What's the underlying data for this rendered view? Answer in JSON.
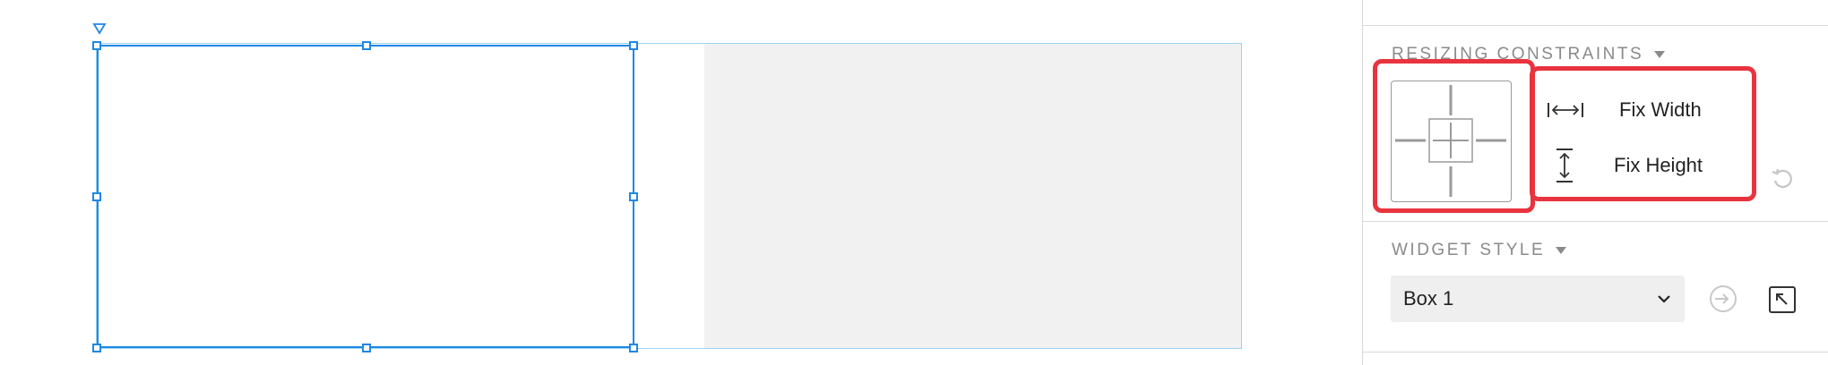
{
  "side_panel": {
    "resizing_constraints": {
      "title": "RESIZING CONSTRAINTS",
      "fix_width_label": "Fix Width",
      "fix_height_label": "Fix Height",
      "reset_icon": "reset-icon"
    },
    "widget_style": {
      "title": "WIDGET STYLE",
      "selected_style": "Box 1",
      "options": [
        "Box 1"
      ],
      "apply_icon": "apply-style-icon",
      "manage_icon": "open-style-editor-icon"
    }
  },
  "colors": {
    "selection_blue": "#1e88e5",
    "highlight_red": "#e8343f",
    "frame_outline": "#9ad4f0",
    "panel_gray": "#f1f1f1",
    "dropdown_bg": "#efefef"
  }
}
